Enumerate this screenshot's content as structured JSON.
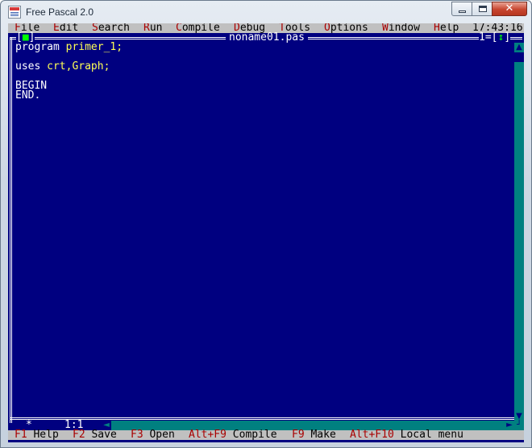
{
  "window": {
    "title": "Free Pascal 2.0",
    "close_glyph": "✕"
  },
  "menu": [
    {
      "hot": "F",
      "rest": "ile"
    },
    {
      "hot": "E",
      "rest": "dit"
    },
    {
      "hot": "S",
      "rest": "earch"
    },
    {
      "hot": "R",
      "rest": "un"
    },
    {
      "hot": "C",
      "rest": "ompile"
    },
    {
      "hot": "D",
      "rest": "ebug"
    },
    {
      "hot": "T",
      "rest": "ools"
    },
    {
      "hot": "O",
      "rest": "ptions"
    },
    {
      "hot": "W",
      "rest": "indow"
    },
    {
      "hot": "H",
      "rest": "elp"
    }
  ],
  "clock": "17:43:16",
  "editor": {
    "close_left": "[",
    "close_mark": "■",
    "close_right": "]",
    "file_name": "noname01.pas",
    "window_number": "1=[",
    "zoom_mark": "↕",
    "zoom_right": "]",
    "position": "1:1",
    "modified_mark": "*",
    "scroll_up": "▲",
    "scroll_down": "▼",
    "scroll_left": "◄",
    "scroll_right": "►",
    "resize_glyph": "┘"
  },
  "code": {
    "line1_kw": "program",
    "line1_id": "primer_1;",
    "line2_kw": "uses",
    "line2_id": "crt,Graph;",
    "line3": "BEGIN",
    "line4": "END."
  },
  "hints": [
    {
      "key": "F1",
      "label": "Help"
    },
    {
      "key": "F2",
      "label": "Save"
    },
    {
      "key": "F3",
      "label": "Open"
    },
    {
      "key": "Alt+F9",
      "label": "Compile"
    },
    {
      "key": "F9",
      "label": "Make"
    },
    {
      "key": "Alt+F10",
      "label": "Local menu"
    }
  ],
  "colors": {
    "background": "#000080",
    "menu_bg": "#c0c0c0",
    "hotkey": "#a80000",
    "identifier": "#ffff55",
    "scrollbar": "#008080"
  }
}
